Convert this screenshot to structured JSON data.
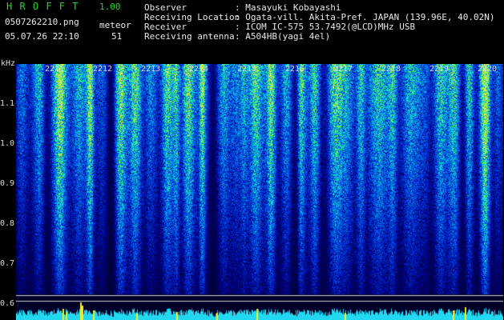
{
  "header": {
    "app_title": "H R O F F T",
    "version": "1.00",
    "filename": "0507262210.png",
    "datetime": "05.07.26 22:10",
    "meteor_label": "meteor",
    "meteor_count": "51",
    "info": [
      {
        "label": "Observer",
        "value": ": Masayuki Kobayashi"
      },
      {
        "label": "Receiving Location",
        "value": ": Ogata-vill. Akita-Pref. JAPAN (139.96E, 40.02N)"
      },
      {
        "label": "Receiver",
        "value": ": ICOM IC-575 53.7492(@LCD)MHz USB"
      },
      {
        "label": "Receiving antenna",
        "value": ": A504HB(yagi 4el)"
      }
    ]
  },
  "axis": {
    "unit": "kHz",
    "y_labels": [
      "1.1",
      "1.0",
      "0.9",
      "0.8",
      "0.7",
      "0.6"
    ],
    "time_labels": [
      "2211",
      "2212",
      "2213",
      "2214",
      "2215",
      "2216",
      "2217",
      "2218",
      "2219",
      "2220"
    ]
  },
  "colors": {
    "background": "#000000",
    "title": "#2bd42b",
    "activity_bar": "#22d8f0",
    "activity_peak": "#f0f020"
  }
}
